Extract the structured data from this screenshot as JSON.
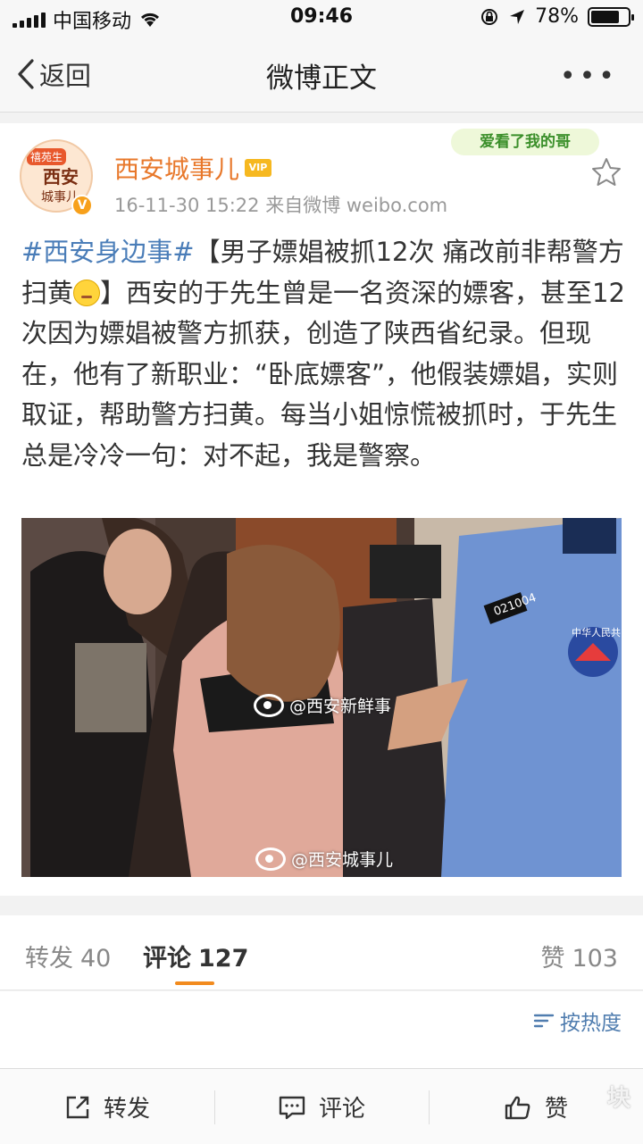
{
  "status_bar": {
    "carrier": "中国移动",
    "time": "09:46",
    "battery": "78%",
    "battery_level": 0.78
  },
  "nav": {
    "back_label": "返回",
    "title": "微博正文",
    "more_label": "•••"
  },
  "post": {
    "avatar": {
      "tag": "禧苑生",
      "title": "西安",
      "subtitle": "城事儿"
    },
    "username": "西安城事儿",
    "vip_label": "VIP",
    "meta": "16-11-30 15:22  来自微博 weibo.com",
    "sticker_text": "爱看了我的哥",
    "text": {
      "hashtag": "#西安身边事#",
      "part1": "【男子嫖娼被抓12次 痛改前非帮警方扫黄",
      "part2": "】西安的于先生曾是一名资深的嫖客，甚至12次因为嫖娼被警方抓获，创造了陕西省纪录。但现在，他有了新职业：“卧底嫖客”，他假装嫖娼，实则取证，帮助警方扫黄。每当小姐惊慌被抓时，于先生总是冷冷一句：对不起，我是警察。"
    },
    "photo": {
      "badge_number": "021004",
      "patch_text": "中华人民共",
      "watermark_1": "@西安新鲜事",
      "watermark_2": "@西安城事儿"
    }
  },
  "tabs": {
    "repost_label": "转发",
    "repost_count": "40",
    "comments_label": "评论",
    "comments_count": "127",
    "likes_label": "赞",
    "likes_count": "103"
  },
  "sort": {
    "label": "按热度"
  },
  "toolbar": {
    "repost": "转发",
    "comment": "评论",
    "like": "赞",
    "corner_watermark": "块"
  },
  "colors": {
    "accent_orange": "#f28b1e",
    "link_blue": "#4a7db8",
    "username_orange": "#e8782b"
  }
}
